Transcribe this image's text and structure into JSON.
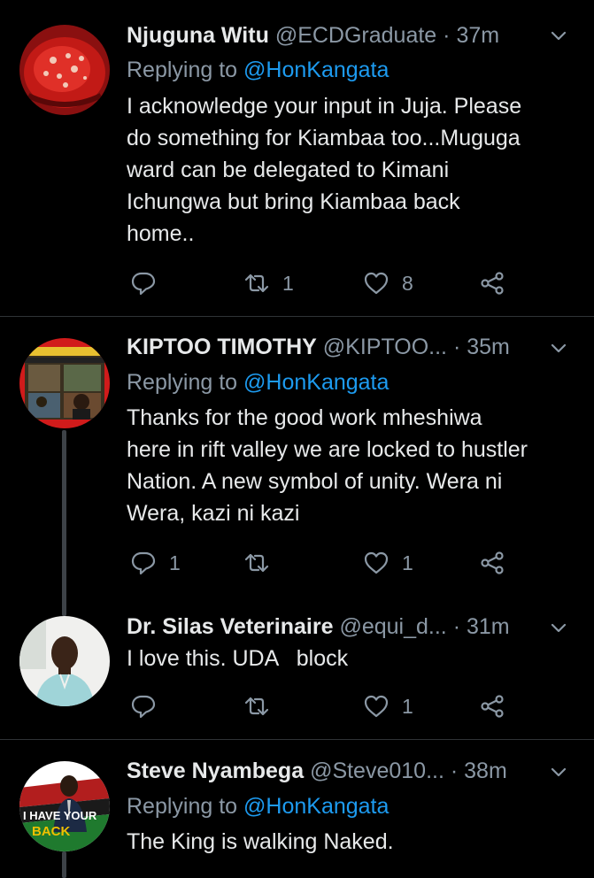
{
  "tweets": [
    {
      "name": "Njuguna Witu",
      "handle": "@ECDGraduate",
      "dot": "·",
      "time": "37m",
      "replying_prefix": "Replying to",
      "replying_to": "@HonKangata",
      "text_lines": [
        "I acknowledge your input in Juja. Please",
        "do something for Kiambaa too...Muguga",
        "ward can be delegated to Kimani",
        "Ichungwa but bring Kiambaa back",
        "home.."
      ],
      "reply_count": "",
      "retweet_count": "1",
      "like_count": "8"
    },
    {
      "name": "KIPTOO TIMOTHY",
      "handle": "@KIPTOO...",
      "dot": "·",
      "time": "35m",
      "replying_prefix": "Replying to",
      "replying_to": "@HonKangata",
      "text_lines": [
        "Thanks for the good work mheshiwa",
        "here in rift valley we are locked to hustler",
        "Nation. A new symbol of unity. Wera ni",
        "Wera, kazi ni kazi"
      ],
      "reply_count": "1",
      "retweet_count": "",
      "like_count": "1"
    },
    {
      "name": "Dr. Silas Veterinaire",
      "handle": "@equi_d...",
      "dot": "·",
      "time": "31m",
      "text_lines": [
        "I love this. UDA   block"
      ],
      "reply_count": "",
      "retweet_count": "",
      "like_count": "1"
    },
    {
      "name": "Steve Nyambega",
      "handle": "@Steve010...",
      "dot": "·",
      "time": "38m",
      "replying_prefix": "Replying to",
      "replying_to": "@HonKangata",
      "text_lines": [
        "The King is walking Naked."
      ],
      "avatar_text": "I HAVE YOUR BACK"
    }
  ],
  "colors": {
    "background": "#000000",
    "text": "#e7e9ea",
    "muted": "#8b98a5",
    "link": "#1d9bf0",
    "divider": "#2f3336"
  },
  "icons": {
    "reply": "speech-bubble-icon",
    "retweet": "retweet-icon",
    "like": "heart-icon",
    "share": "share-icon",
    "more": "chevron-down-icon"
  }
}
